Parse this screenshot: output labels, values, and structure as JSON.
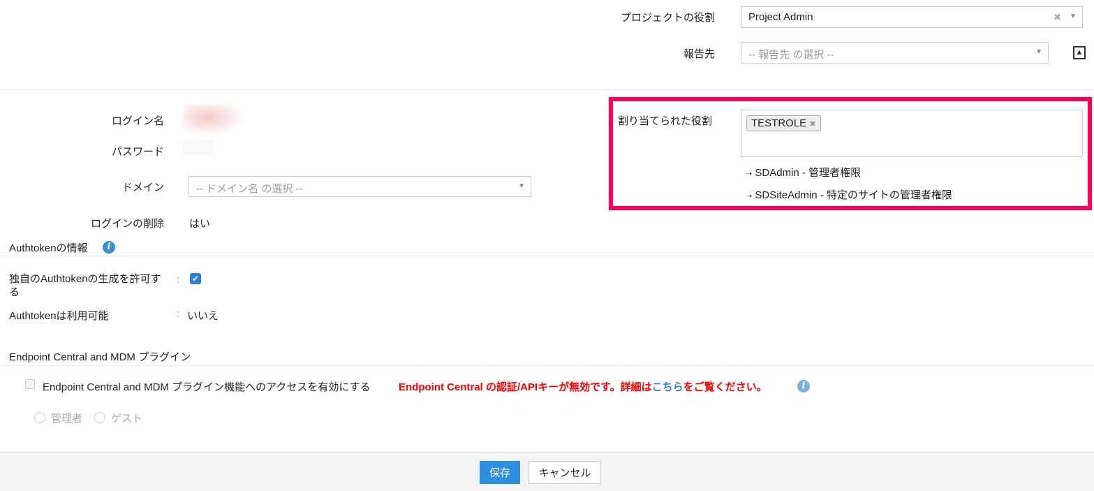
{
  "project_role": {
    "label": "プロジェクトの役割",
    "value": "Project Admin"
  },
  "reports_to": {
    "label": "報告先",
    "placeholder": "-- 報告先 の選択 --"
  },
  "assigned_roles": {
    "label": "割り当てられた役割",
    "tags": [
      "TESTROLE"
    ],
    "items": [
      "SDAdmin - 管理者権限",
      "SDSiteAdmin - 特定のサイトの管理者権限"
    ],
    "highlight_color": "#ff0055"
  },
  "login": {
    "name_label": "ログイン名",
    "password_label": "パスワード",
    "domain_label": "ドメイン",
    "domain_placeholder": "-- ドメイン名 の選択 --",
    "delete_label": "ログインの削除",
    "delete_value": "はい"
  },
  "authtoken": {
    "title": "Authtokenの情報",
    "allow_label": "独自のAuthtokenの生成を許可する",
    "allow_checked": true,
    "available_label": "Authtokenは利用可能",
    "available_value": "いいえ",
    "sep": ":"
  },
  "plugin": {
    "title": "Endpoint Central and MDM プラグイン",
    "enable_label": "Endpoint Central and MDM プラグイン機能へのアクセスを有効にする",
    "error_prefix": "Endpoint Central の認証/APIキーが無効です。詳細は",
    "error_link": "こちら",
    "error_suffix": "をご覧ください。",
    "radio_admin": "管理者",
    "radio_guest": "ゲスト"
  },
  "footer": {
    "save": "保存",
    "cancel": "キャンセル"
  }
}
